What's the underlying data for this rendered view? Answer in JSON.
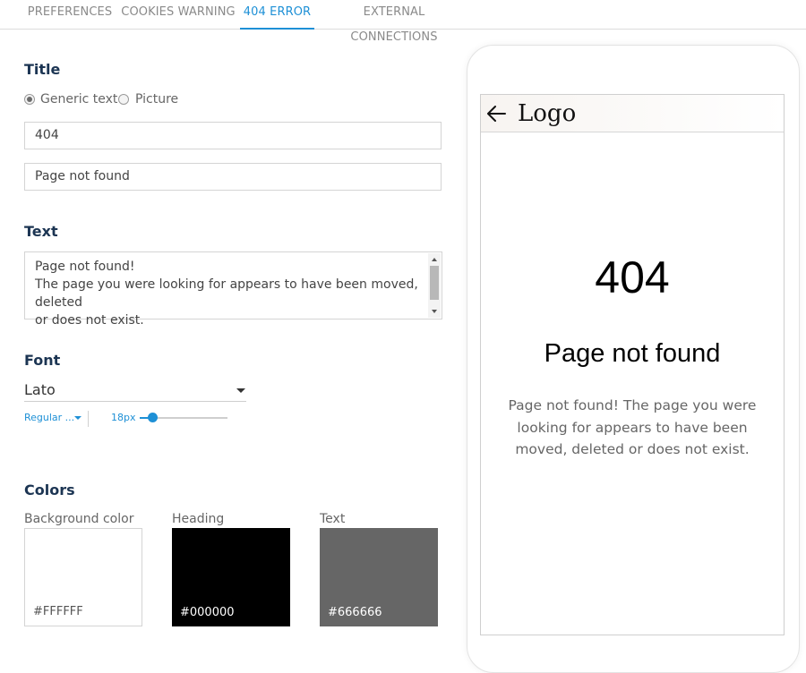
{
  "tabs": [
    {
      "label": "PREFERENCES",
      "active": false
    },
    {
      "label": "COOKIES WARNING",
      "active": false
    },
    {
      "label": "404 ERROR",
      "active": true
    },
    {
      "label": "EXTERNAL CONNECTIONS",
      "active": false
    }
  ],
  "title_section": {
    "heading": "Title",
    "radio_options": [
      {
        "label": "Generic text",
        "checked": true
      },
      {
        "label": "Picture",
        "checked": false
      }
    ],
    "title_value": "404",
    "subtitle_value": "Page not found"
  },
  "text_section": {
    "heading": "Text",
    "value": "Page not found!\nThe page you were looking for appears to have been moved, deleted\nor does not exist."
  },
  "font_section": {
    "heading": "Font",
    "family": "Lato",
    "weight": "Regular ...",
    "size_label": "18px",
    "size_fraction": 0.15
  },
  "colors_section": {
    "heading": "Colors",
    "swatches": [
      {
        "label": "Background color",
        "hex": "#FFFFFF"
      },
      {
        "label": "Heading",
        "hex": "#000000"
      },
      {
        "label": "Text",
        "hex": "#666666"
      }
    ]
  },
  "preview": {
    "logo": "Logo",
    "title": "404",
    "subtitle": "Page not found",
    "message": "Page not found! The page you were looking for appears to have been moved, deleted or does not exist."
  },
  "accent_color": "#1E90D6",
  "icons": {
    "back": "arrow-left-icon"
  }
}
